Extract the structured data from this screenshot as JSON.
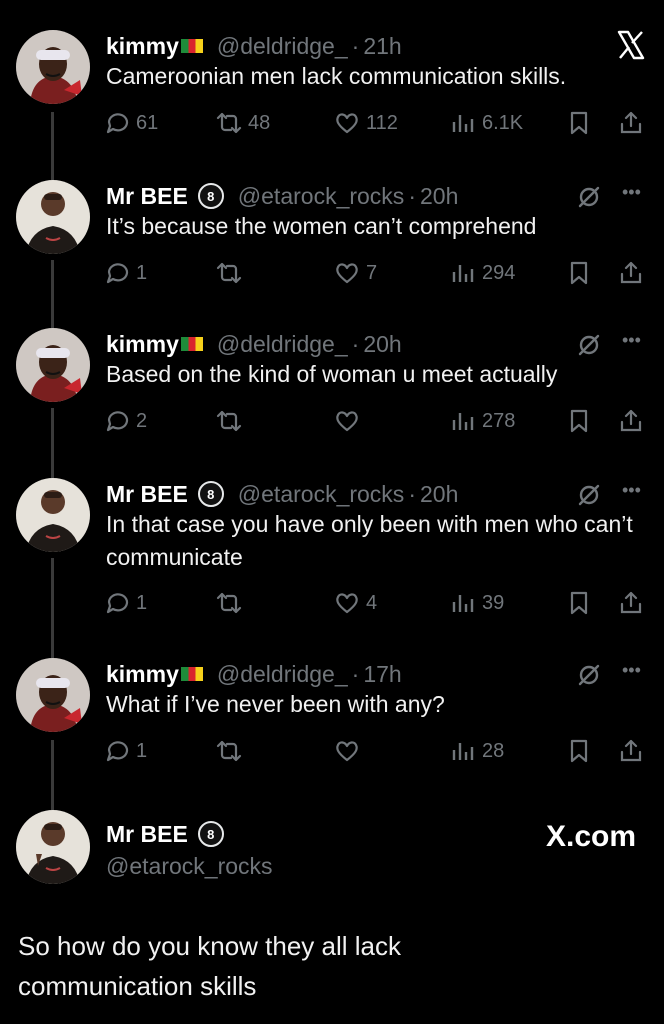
{
  "tweets": [
    {
      "name": "kimmy",
      "handle": "@deldridge_",
      "time": "21h",
      "text": "Cameroonian men lack communication skills.",
      "replies": "61",
      "retweets": "48",
      "likes": "112",
      "views": "6.1K",
      "flag": true
    },
    {
      "name": "Mr BEE",
      "handle": "@etarock_rocks",
      "time": "20h",
      "text": "It’s because the women can’t comprehend",
      "replies": "1",
      "retweets": "",
      "likes": "7",
      "views": "294"
    },
    {
      "name": "kimmy",
      "handle": "@deldridge_",
      "time": "20h",
      "text": "Based on the kind of woman u meet actually",
      "replies": "2",
      "retweets": "",
      "likes": "",
      "views": "278",
      "flag": true
    },
    {
      "name": "Mr BEE",
      "handle": "@etarock_rocks",
      "time": "20h",
      "text": "In that case you have only been with men who can’t communicate",
      "replies": "1",
      "retweets": "",
      "likes": "4",
      "views": "39"
    },
    {
      "name": "kimmy",
      "handle": "@deldridge_",
      "time": "17h",
      "text": "What if I’ve never been with any?",
      "replies": "1",
      "retweets": "",
      "likes": "",
      "views": "28",
      "flag": true
    }
  ],
  "final": {
    "name": "Mr BEE",
    "badge": "8",
    "handle": "@etarock_rocks",
    "brand": "X.com",
    "text": "So how do you know they all lack communication skills"
  },
  "badge_text": "8",
  "colors": {
    "background": "#000000",
    "muted": "#71767b",
    "text": "#e7e9ea"
  },
  "icons": [
    "x-logo-icon",
    "reply-icon",
    "retweet-icon",
    "like-icon",
    "views-icon",
    "bookmark-icon",
    "share-icon",
    "grok-icon",
    "more-icon"
  ]
}
